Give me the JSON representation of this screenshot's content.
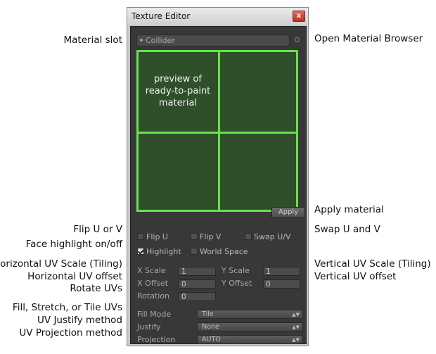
{
  "window": {
    "title": "Texture Editor",
    "close_glyph": "x"
  },
  "material_slot": {
    "value": "Collider"
  },
  "preview": {
    "text": "preview of ready-to-paint material"
  },
  "apply_label": "Apply",
  "toggles": {
    "flip_u": {
      "label": "Flip U",
      "checked": false
    },
    "flip_v": {
      "label": "Flip V",
      "checked": false
    },
    "swap_uv": {
      "label": "Swap U/V",
      "checked": false
    },
    "highlight": {
      "label": "Highlight",
      "checked": true
    },
    "world_space": {
      "label": "World Space",
      "checked": false
    }
  },
  "fields": {
    "x_scale": {
      "label": "X Scale",
      "value": "1"
    },
    "y_scale": {
      "label": "Y Scale",
      "value": "1"
    },
    "x_offset": {
      "label": "X Offset",
      "value": "0"
    },
    "y_offset": {
      "label": "Y Offset",
      "value": "0"
    },
    "rotation": {
      "label": "Rotation",
      "value": "0"
    }
  },
  "dropdowns": {
    "fill_mode": {
      "label": "Fill Mode",
      "value": "Tile"
    },
    "justify": {
      "label": "Justify",
      "value": "None"
    },
    "projection": {
      "label": "Projection",
      "value": "AUTO"
    }
  },
  "callouts": {
    "left": {
      "material_slot": "Material slot",
      "flip": "Flip U or V",
      "face_highlight": "Face highlight on/off",
      "h_scale": "Horizontal UV Scale (Tiling)",
      "h_offset": "Horizontal UV offset",
      "rotate": "Rotate UVs",
      "fill": "Fill, Stretch, or Tile UVs",
      "justify": "UV Justify method",
      "projection": "UV Projection method"
    },
    "right": {
      "browser": "Open Material Browser",
      "apply": "Apply material",
      "swap": "Swap U and V",
      "v_scale": "Vertical UV Scale (Tiling)",
      "v_offset": "Vertical UV offset"
    }
  }
}
